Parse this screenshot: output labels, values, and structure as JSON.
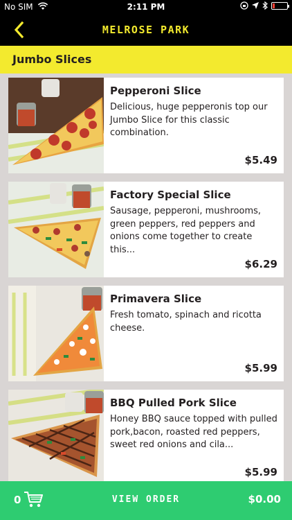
{
  "status_bar": {
    "carrier": "No SIM",
    "time": "2:11 PM"
  },
  "nav": {
    "title": "MELROSE PARK"
  },
  "section": {
    "title": "Jumbo Slices"
  },
  "items": [
    {
      "name": "Pepperoni Slice",
      "description": "Delicious, huge pepperonis top our Jumbo Slice for this classic combination.",
      "price": "$5.49"
    },
    {
      "name": "Factory Special Slice",
      "description": "Sausage, pepperoni, mushrooms, green peppers, red peppers and onions come together to create this...",
      "price": "$6.29"
    },
    {
      "name": "Primavera Slice",
      "description": "Fresh tomato, spinach and ricotta cheese.",
      "price": "$5.99"
    },
    {
      "name": "BBQ Pulled Pork Slice",
      "description": "Honey BBQ sauce topped with pulled pork,bacon, roasted red peppers, sweet red onions and cila...",
      "price": "$5.99"
    }
  ],
  "order_bar": {
    "count": "0",
    "label": "VIEW ORDER",
    "total": "$0.00"
  },
  "colors": {
    "accent_yellow": "#f3ea2e",
    "order_green": "#2ecc71",
    "nav_black": "#000000",
    "list_background": "#d9d5d4"
  }
}
